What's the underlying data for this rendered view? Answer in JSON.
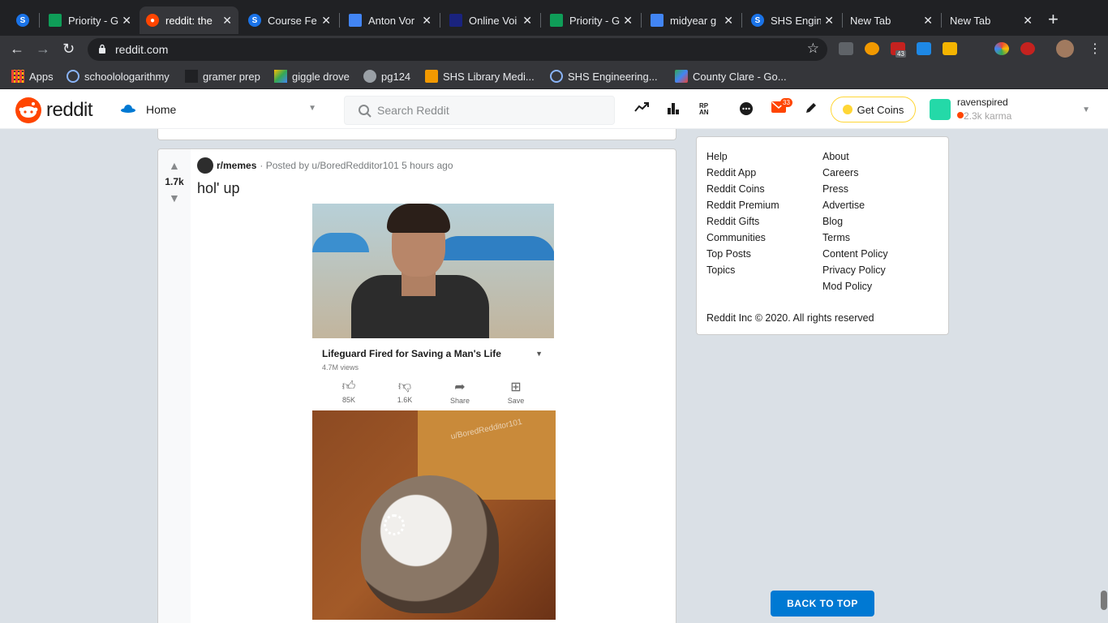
{
  "browser": {
    "tabs": [
      {
        "title": "",
        "active": false
      },
      {
        "title": "Priority - G",
        "active": false
      },
      {
        "title": "reddit: the",
        "active": true
      },
      {
        "title": "Course Fe",
        "active": false
      },
      {
        "title": "Anton Vor",
        "active": false
      },
      {
        "title": "Online Voi",
        "active": false
      },
      {
        "title": "Priority - G",
        "active": false
      },
      {
        "title": "midyear g",
        "active": false
      },
      {
        "title": "SHS Engin",
        "active": false
      },
      {
        "title": "New Tab",
        "active": false
      },
      {
        "title": "New Tab",
        "active": false
      }
    ],
    "new_tab_label": "+",
    "url": "reddit.com",
    "bookmarks": [
      "Apps",
      "schoolologarithmy",
      "gramer prep",
      "giggle drove",
      "pg124",
      "SHS Library Medi...",
      "SHS Engineering...",
      "County Clare - Go..."
    ],
    "extension_badge": "43"
  },
  "reddit": {
    "logo_text": "reddit",
    "home_label": "Home",
    "search_placeholder": "Search Reddit",
    "mail_badge": "33",
    "get_coins_label": "Get Coins",
    "username": "ravenspired",
    "karma": "2.3k karma"
  },
  "post": {
    "score": "1.7k",
    "subreddit": "r/memes",
    "posted_by": "· Posted by u/BoredRedditor101 5 hours ago",
    "title": "hol' up",
    "image": {
      "video_title": "Lifeguard Fired for Saving a Man's Life",
      "views": "4.7M views",
      "actions": [
        {
          "icon": "thumbs-up-icon",
          "label": "85K"
        },
        {
          "icon": "thumbs-down-icon",
          "label": "1.6K"
        },
        {
          "icon": "share-icon",
          "label": "Share"
        },
        {
          "icon": "save-icon",
          "label": "Save"
        }
      ],
      "watermark": "u/BoredRedditor101"
    }
  },
  "sidebar": {
    "col1": [
      "Help",
      "Reddit App",
      "Reddit Coins",
      "Reddit Premium",
      "Reddit Gifts",
      "Communities",
      "Top Posts",
      "Topics"
    ],
    "col2": [
      "About",
      "Careers",
      "Press",
      "Advertise",
      "Blog",
      "Terms",
      "Content Policy",
      "Privacy Policy",
      "Mod Policy"
    ],
    "copyright": "Reddit Inc © 2020. All rights reserved"
  },
  "back_to_top_label": "BACK TO TOP"
}
